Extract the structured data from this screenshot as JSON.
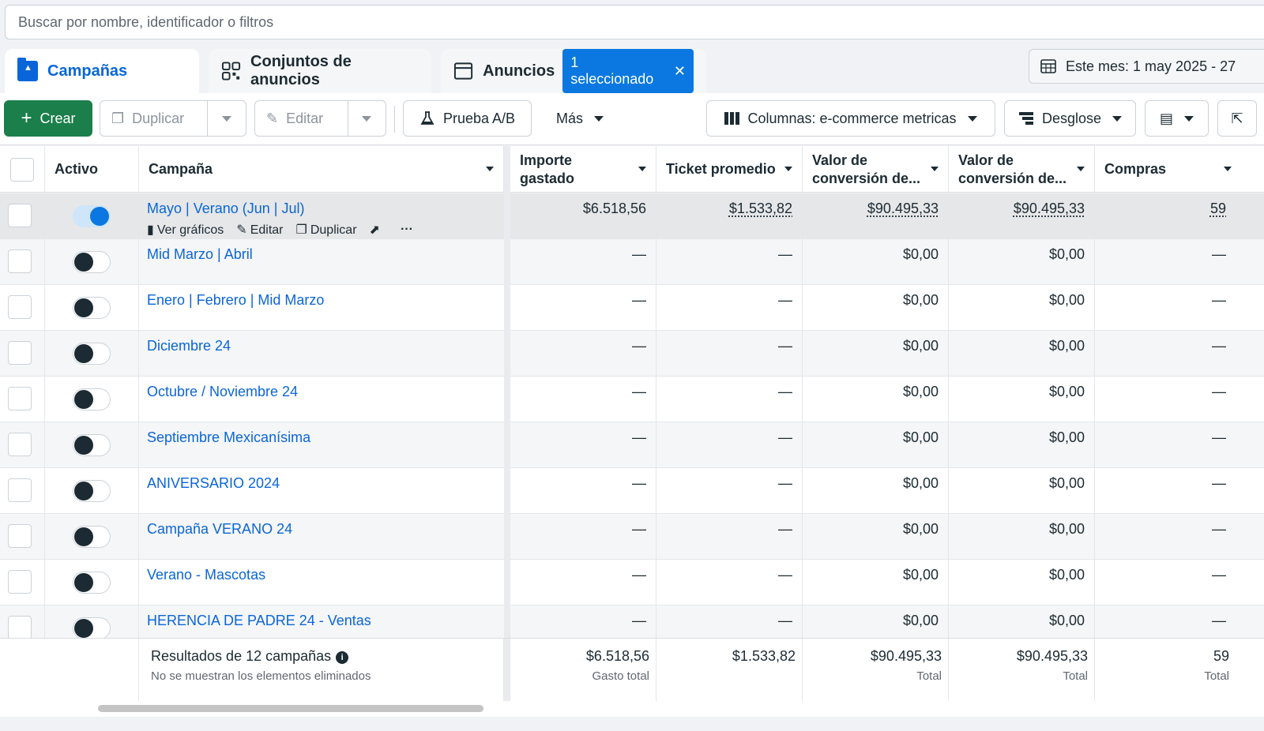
{
  "search": {
    "placeholder": "Buscar por nombre, identificador o filtros"
  },
  "tabs": {
    "campaigns": "Campañas",
    "adsets": "Conjuntos de anuncios",
    "ads": "Anuncios",
    "selected_badge": "1 seleccionado"
  },
  "date_range": "Este mes: 1 may 2025 - 27",
  "toolbar": {
    "create": "Crear",
    "duplicate": "Duplicar",
    "edit": "Editar",
    "ab_test": "Prueba A/B",
    "more": "Más",
    "columns": "Columnas: e-commerce metricas",
    "breakdown": "Desglose"
  },
  "columns": {
    "active": "Activo",
    "campaign": "Campaña",
    "spent_l1": "Importe",
    "spent_l2": "gastado",
    "ticket": "Ticket promedio",
    "conv1_l1": "Valor de",
    "conv1_l2": "conversión de...",
    "conv2_l1": "Valor de",
    "conv2_l2": "conversión de...",
    "purchases": "Compras"
  },
  "row_actions": {
    "charts": "Ver gráficos",
    "edit": "Editar",
    "duplicate": "Duplicar"
  },
  "rows": [
    {
      "name": "Mayo | Verano (Jun | Jul)",
      "spent": "$6.518,56",
      "ticket": "$1.533,82",
      "conv1": "$90.495,33",
      "conv2": "$90.495,33",
      "purchases": "59",
      "active": true
    },
    {
      "name": "Mid Marzo | Abril",
      "spent": "—",
      "ticket": "—",
      "conv1": "$0,00",
      "conv2": "$0,00",
      "purchases": "—",
      "active": false
    },
    {
      "name": "Enero | Febrero | Mid Marzo",
      "spent": "—",
      "ticket": "—",
      "conv1": "$0,00",
      "conv2": "$0,00",
      "purchases": "—",
      "active": false
    },
    {
      "name": "Diciembre 24",
      "spent": "—",
      "ticket": "—",
      "conv1": "$0,00",
      "conv2": "$0,00",
      "purchases": "—",
      "active": false
    },
    {
      "name": "Octubre / Noviembre 24",
      "spent": "—",
      "ticket": "—",
      "conv1": "$0,00",
      "conv2": "$0,00",
      "purchases": "—",
      "active": false
    },
    {
      "name": "Septiembre Mexicanísima",
      "spent": "—",
      "ticket": "—",
      "conv1": "$0,00",
      "conv2": "$0,00",
      "purchases": "—",
      "active": false
    },
    {
      "name": "ANIVERSARIO 2024",
      "spent": "—",
      "ticket": "—",
      "conv1": "$0,00",
      "conv2": "$0,00",
      "purchases": "—",
      "active": false
    },
    {
      "name": "Campaña VERANO 24",
      "spent": "—",
      "ticket": "—",
      "conv1": "$0,00",
      "conv2": "$0,00",
      "purchases": "—",
      "active": false
    },
    {
      "name": "Verano - Mascotas",
      "spent": "—",
      "ticket": "—",
      "conv1": "$0,00",
      "conv2": "$0,00",
      "purchases": "—",
      "active": false
    },
    {
      "name": "HERENCIA DE PADRE 24 - Ventas",
      "spent": "—",
      "ticket": "—",
      "conv1": "$0,00",
      "conv2": "$0,00",
      "purchases": "—",
      "active": false
    }
  ],
  "footer": {
    "results": "Resultados de 12 campañas",
    "note": "No se muestran los elementos eliminados",
    "spent": "$6.518,56",
    "spent_label": "Gasto total",
    "ticket": "$1.533,82",
    "conv1": "$90.495,33",
    "conv1_label": "Total",
    "conv2": "$90.495,33",
    "conv2_label": "Total",
    "purchases": "59",
    "purchases_label": "Total"
  },
  "colors": {
    "accent": "#0a66d8",
    "create": "#1a7f4b",
    "badge": "#0a78e0"
  }
}
